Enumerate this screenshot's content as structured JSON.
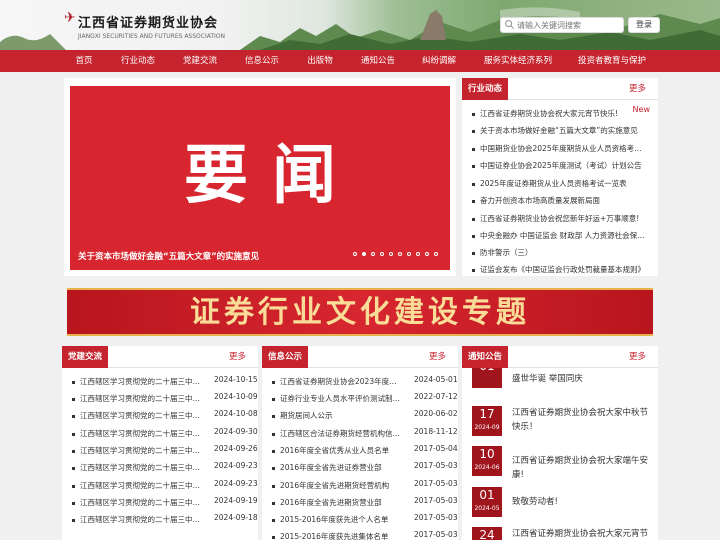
{
  "header": {
    "site_title": "江西省证券期货业协会",
    "site_subtitle": "JIANGXI SECURITIES AND FUTURES ASSOCIATION",
    "search_placeholder": "请输入关键词搜索",
    "login_label": "登录"
  },
  "nav": [
    "首页",
    "行业动态",
    "党建交流",
    "信息公示",
    "出版物",
    "通知公告",
    "纠纷调解",
    "服务实体经济系列",
    "投资者教育与保护"
  ],
  "banner": {
    "image_text": "要闻",
    "caption": "关于资本市场做好金融“五篇大文章”的实施意见",
    "slide_count": 10,
    "active_slide": 2
  },
  "industry": {
    "title": "行业动态",
    "more": "更多",
    "new_badge": "New",
    "items": [
      "江西省证券期货业协会祝大家元宵节快乐!",
      "关于资本市场做好金融“五篇大文章”的实施意见",
      "中国期货业协会2025年度期货从业人员资格考试...",
      "中国证券业协会2025年度测试（考试）计划公告",
      "2025年度证券期货从业人员资格考试一览表",
      "奋力开创资本市场高质量发展新局面",
      "江西省证券期货业协会祝您新年好运+万事顺意!",
      "中央金融办 中国证监会 财政部 人力资源社会保障...",
      "防非警示（三）",
      "证监会发布《中国证监会行政处罚裁量基本规则》"
    ]
  },
  "culture": {
    "text": "证券行业文化建设专题"
  },
  "party": {
    "title": "党建交流",
    "more": "更多",
    "items": [
      {
        "t": "江西辖区学习贯彻党的二十届三中全会...",
        "d": "2024-10-15"
      },
      {
        "t": "江西辖区学习贯彻党的二十届三中全会...",
        "d": "2024-10-09"
      },
      {
        "t": "江西辖区学习贯彻党的二十届三中全会...",
        "d": "2024-10-08"
      },
      {
        "t": "江西辖区学习贯彻党的二十届三中全会...",
        "d": "2024-09-30"
      },
      {
        "t": "江西辖区学习贯彻党的二十届三中全会...",
        "d": "2024-09-26"
      },
      {
        "t": "江西辖区学习贯彻党的二十届三中全会...",
        "d": "2024-09-23"
      },
      {
        "t": "江西辖区学习贯彻党的二十届三中全会...",
        "d": "2024-09-23"
      },
      {
        "t": "江西辖区学习贯彻党的二十届三中全会...",
        "d": "2024-09-19"
      },
      {
        "t": "江西辖区学习贯彻党的二十届三中全会...",
        "d": "2024-09-18"
      }
    ]
  },
  "info": {
    "title": "信息公示",
    "more": "更多",
    "items": [
      {
        "t": "江西省证券期货业协会2023年度表彰...",
        "d": "2024-05-01"
      },
      {
        "t": "证券行业专业人员水平评价测试制度暨...",
        "d": "2022-07-12"
      },
      {
        "t": "期货居间人公示",
        "d": "2020-06-02"
      },
      {
        "t": "江西辖区合法证券期货经营机构信息公示",
        "d": "2018-11-12"
      },
      {
        "t": "2016年度全省优秀从业人员名单",
        "d": "2017-05-04"
      },
      {
        "t": "2016年度全省先进证券营业部",
        "d": "2017-05-03"
      },
      {
        "t": "2016年度全省先进期货经营机构",
        "d": "2017-05-03"
      },
      {
        "t": "2016年度全省先进期货营业部",
        "d": "2017-05-03"
      },
      {
        "t": "2015-2016年度获先进个人名单",
        "d": "2017-05-03"
      },
      {
        "t": "2015-2016年度获先进集体名单",
        "d": "2017-05-03"
      }
    ]
  },
  "notice": {
    "title": "通知公告",
    "more": "更多",
    "items": [
      {
        "day": "01",
        "year": "",
        "t": "盛世华诞 举国同庆"
      },
      {
        "day": "17",
        "year": "2024-09",
        "t": "江西省证券期货业协会祝大家中秋节快乐！"
      },
      {
        "day": "10",
        "year": "2024-06",
        "t": "江西省证券期货业协会祝大家端午安康!"
      },
      {
        "day": "01",
        "year": "2024-05",
        "t": "致敬劳动者!"
      },
      {
        "day": "24",
        "year": "",
        "t": "江西省证券期货业协会祝大家元宵节快乐"
      }
    ]
  },
  "colors": {
    "brand_red": "#c5232d",
    "notice_date_bg": "#a0141c",
    "culture_text": "#f8dc97"
  }
}
